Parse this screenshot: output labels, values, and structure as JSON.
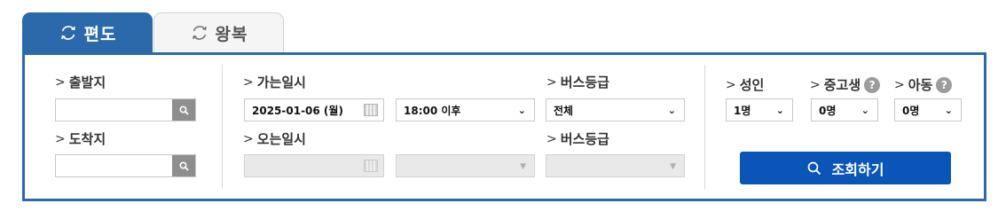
{
  "tabs": [
    {
      "label": "편도",
      "icon": "refresh-icon"
    },
    {
      "label": "왕복",
      "icon": "refresh-icon"
    }
  ],
  "colors": {
    "accent": "#2b69ab",
    "button": "#0a55b7"
  },
  "departure": {
    "label": "출발지",
    "value": ""
  },
  "arrival": {
    "label": "도착지",
    "value": ""
  },
  "go_date": {
    "label": "가는일시",
    "date": "2025-01-06 (월)",
    "time": "18:00 이후"
  },
  "return_date": {
    "label": "오는일시",
    "date": "",
    "time": ""
  },
  "bus_class_go": {
    "label": "버스등급",
    "value": "전체"
  },
  "bus_class_return": {
    "label": "버스등급",
    "value": ""
  },
  "adult": {
    "label": "성인",
    "value": "1명"
  },
  "youth": {
    "label": "중고생",
    "value": "0명"
  },
  "child": {
    "label": "아동",
    "value": "0명"
  },
  "help_mark": "?",
  "search_button": "조회하기"
}
